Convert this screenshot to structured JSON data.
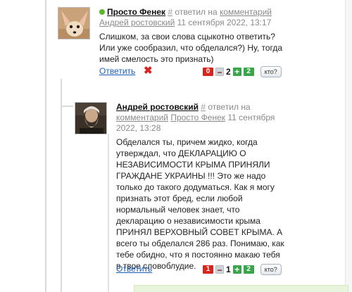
{
  "comments": [
    {
      "author": "Просто Фенек",
      "reply_marker": "#",
      "replied_to_prefix": "ответил на",
      "replied_to_link": "комментарий",
      "reply_target": "Андрей ростовский",
      "timestamp": "11 сентября 2022, 13:17",
      "body": "Слишком, за свои слова сцыкотно ответить? Или уже сообразил, что обделался?) Ну, тогда имей смелость это признать)",
      "reply_label": "Ответить",
      "delete_symbol": "✖",
      "votes": {
        "minus_count": "0",
        "minus_symbol": "−",
        "score": "2",
        "plus_symbol": "+",
        "plus_count": "2",
        "who_label": "кто?"
      },
      "online_color": "#5cb82b"
    },
    {
      "author": "Андрей ростовский",
      "reply_marker": "#",
      "replied_to_prefix": "ответил на",
      "replied_to_link": "комментарий",
      "reply_target": "Просто Фенек",
      "timestamp_line1": "11 сентября",
      "timestamp_line2": "2022, 13:28",
      "body": "Обделался ты, причем жидко, когда утверждал, что ДЕКЛАРАЦИЮ О НЕЗАВИСИМОСТИ КРЫМА ПРИНЯЛИ ГРАЖДАНЕ УКРАИНЫ !!! Это же надо только до такого додуматься. Как я могу признать этот бред, если любой нормальный человек знает, что декларацию о независимости крыма ПРИНЯЛ ВЕРХОВНЫЙ СОВЕТ КРЫМА. А всего ты обделался 286 раз. Понимаю, как тебе обидно, что я постоянно макаю тебя в твое словоблудие.",
      "reply_label": "Ответить",
      "votes": {
        "minus_count": "1",
        "minus_symbol": "−",
        "score": "1",
        "plus_symbol": "+",
        "plus_count": "2",
        "who_label": "кто?"
      }
    }
  ],
  "colors": {
    "link": "#1d5fb8",
    "negative": "#d9261c",
    "positive": "#3aa64a",
    "reply_box": "#e8f4dc"
  }
}
